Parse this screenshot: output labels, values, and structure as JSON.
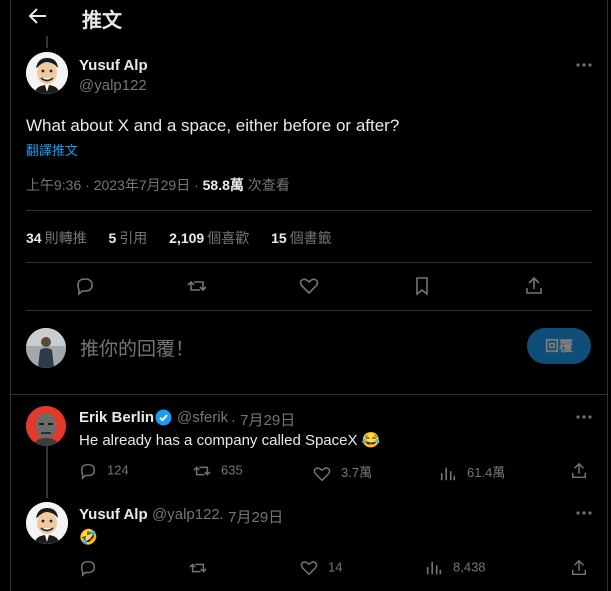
{
  "header": {
    "title": "推文"
  },
  "main_tweet": {
    "name": "Yusuf Alp",
    "handle": "@yalp122",
    "text": "What about X and a space, either before or after?",
    "translate": "翻譯推文",
    "time": "上午9:36 · 2023年7月29日 · ",
    "views": "58.8萬",
    "views_label": " 次查看",
    "stats": [
      {
        "value": "34",
        "label": "則轉推"
      },
      {
        "value": "5",
        "label": "引用"
      },
      {
        "value": "2,109",
        "label": "個喜歡"
      },
      {
        "value": "15",
        "label": "個書籤"
      }
    ]
  },
  "reply_box": {
    "placeholder": "推你的回覆！",
    "button": "回覆"
  },
  "replies": [
    {
      "name": "Erik Berlin",
      "handle": "@sferik",
      "date": "· 7月29日",
      "text": "He already has a company called SpaceX 😂",
      "replies": "124",
      "retweets": "635",
      "likes": "3.7萬",
      "views": "61.4萬"
    },
    {
      "name": "Yusuf Alp",
      "handle": "@yalp122",
      "date": "· 7月29日",
      "text": "🤣",
      "replies": "",
      "retweets": "",
      "likes": "14",
      "views": "8,438"
    }
  ],
  "colors": {
    "accent": "#1d9bf0",
    "verified": "#1d9bf0",
    "muted": "#71767b"
  }
}
